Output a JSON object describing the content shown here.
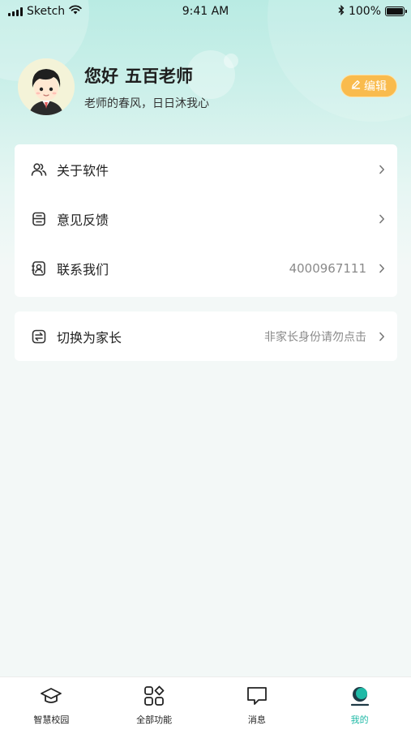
{
  "status_bar": {
    "carrier": "Sketch",
    "time": "9:41 AM",
    "battery": "100%"
  },
  "profile": {
    "greeting": "您好",
    "name": "五百老师",
    "motto": "老师的春风，日日沐我心",
    "edit_label": "编辑"
  },
  "menu": [
    {
      "label": "关于软件",
      "value": "",
      "icon": "users-icon"
    },
    {
      "label": "意见反馈",
      "value": "",
      "icon": "feedback-icon"
    },
    {
      "label": "联系我们",
      "value": "4000967111",
      "icon": "contact-icon"
    }
  ],
  "switch_role": {
    "label": "切换为家长",
    "hint": "非家长身份请勿点击",
    "icon": "switch-icon"
  },
  "tabs": [
    {
      "label": "智慧校园",
      "icon": "graduation-cap-icon",
      "active": false
    },
    {
      "label": "全部功能",
      "icon": "apps-grid-icon",
      "active": false
    },
    {
      "label": "消息",
      "icon": "message-icon",
      "active": false
    },
    {
      "label": "我的",
      "icon": "profile-icon",
      "active": true
    }
  ],
  "colors": {
    "accent": "#1fb9a6",
    "edit_button": "#f9bb4d",
    "header_gradient": "#b9ebe3"
  }
}
